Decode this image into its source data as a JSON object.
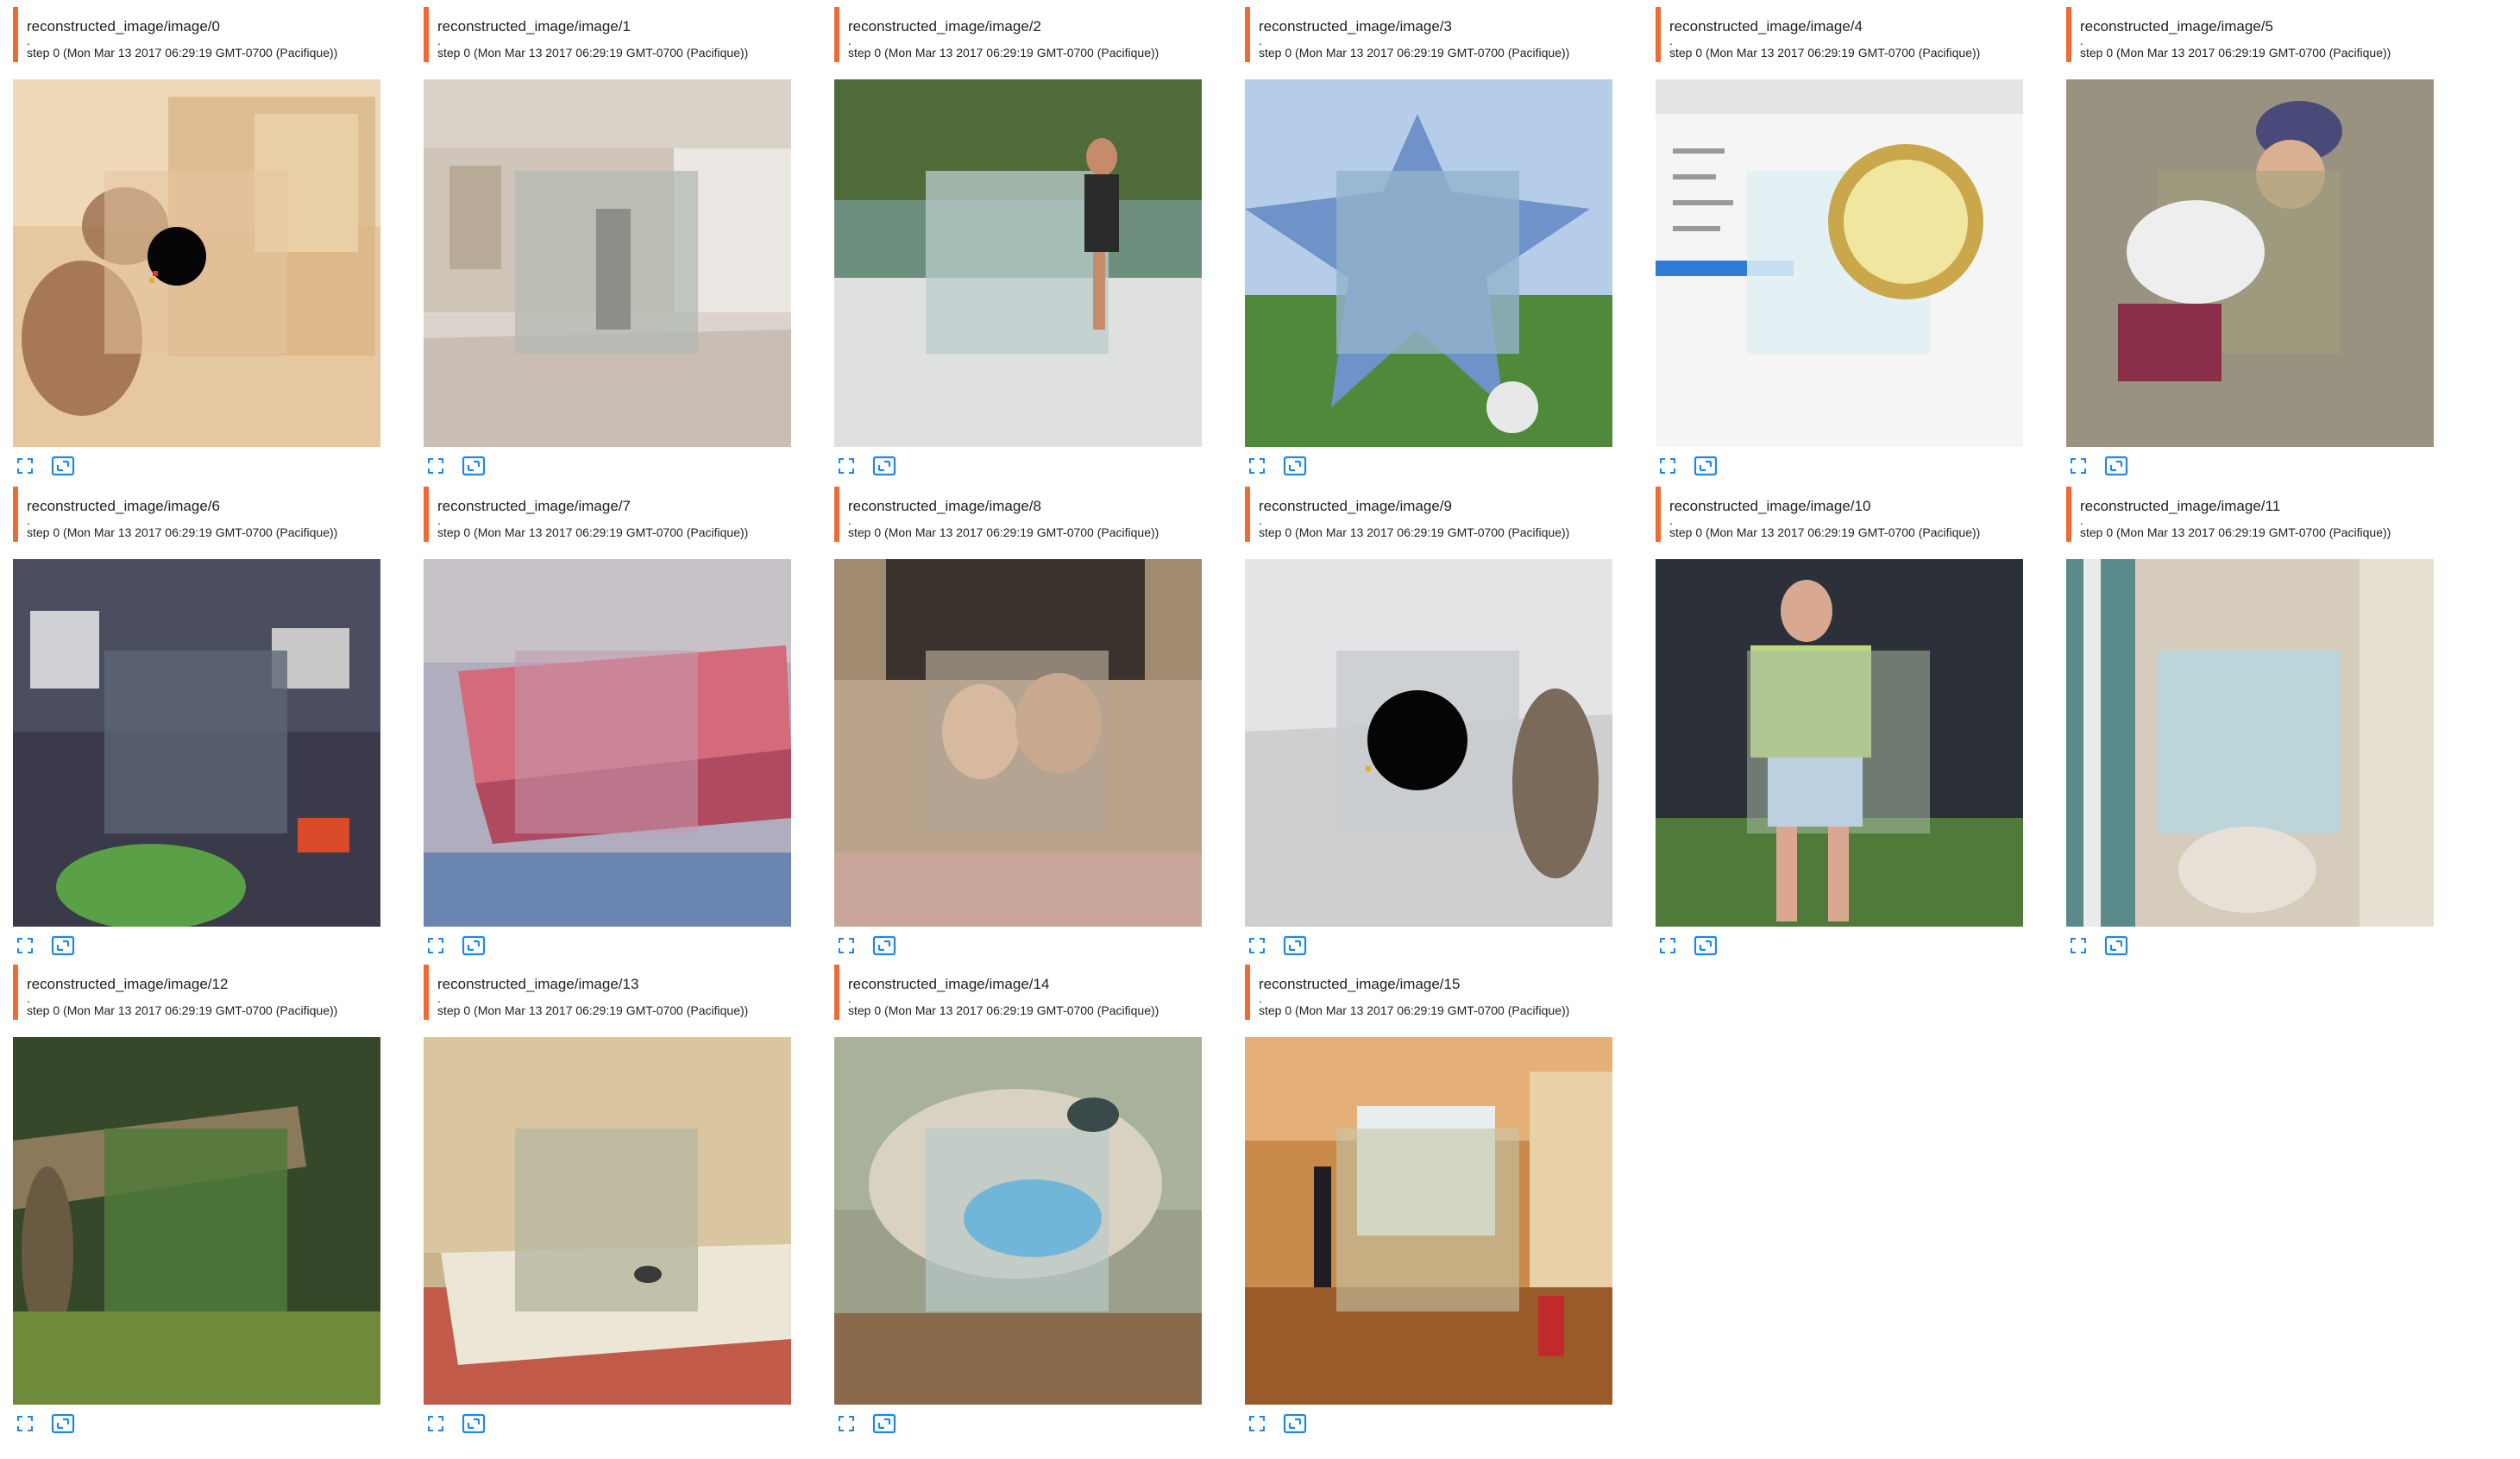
{
  "cards": [
    {
      "title": "reconstructed_image/image/0",
      "dot": ".",
      "step": "step 0 (Mon Mar 13 2017 06:29:19 GMT-0700 (Pacifique))"
    },
    {
      "title": "reconstructed_image/image/1",
      "dot": ".",
      "step": "step 0 (Mon Mar 13 2017 06:29:19 GMT-0700 (Pacifique))"
    },
    {
      "title": "reconstructed_image/image/2",
      "dot": ".",
      "step": "step 0 (Mon Mar 13 2017 06:29:19 GMT-0700 (Pacifique))"
    },
    {
      "title": "reconstructed_image/image/3",
      "dot": ".",
      "step": "step 0 (Mon Mar 13 2017 06:29:19 GMT-0700 (Pacifique))"
    },
    {
      "title": "reconstructed_image/image/4",
      "dot": ".",
      "step": "step 0 (Mon Mar 13 2017 06:29:19 GMT-0700 (Pacifique))"
    },
    {
      "title": "reconstructed_image/image/5",
      "dot": ".",
      "step": "step 0 (Mon Mar 13 2017 06:29:19 GMT-0700 (Pacifique))"
    },
    {
      "title": "reconstructed_image/image/6",
      "dot": ".",
      "step": "step 0 (Mon Mar 13 2017 06:29:19 GMT-0700 (Pacifique))"
    },
    {
      "title": "reconstructed_image/image/7",
      "dot": ".",
      "step": "step 0 (Mon Mar 13 2017 06:29:19 GMT-0700 (Pacifique))"
    },
    {
      "title": "reconstructed_image/image/8",
      "dot": ".",
      "step": "step 0 (Mon Mar 13 2017 06:29:19 GMT-0700 (Pacifique))"
    },
    {
      "title": "reconstructed_image/image/9",
      "dot": ".",
      "step": "step 0 (Mon Mar 13 2017 06:29:19 GMT-0700 (Pacifique))"
    },
    {
      "title": "reconstructed_image/image/10",
      "dot": ".",
      "step": "step 0 (Mon Mar 13 2017 06:29:19 GMT-0700 (Pacifique))"
    },
    {
      "title": "reconstructed_image/image/11",
      "dot": ".",
      "step": "step 0 (Mon Mar 13 2017 06:29:19 GMT-0700 (Pacifique))"
    },
    {
      "title": "reconstructed_image/image/12",
      "dot": ".",
      "step": "step 0 (Mon Mar 13 2017 06:29:19 GMT-0700 (Pacifique))"
    },
    {
      "title": "reconstructed_image/image/13",
      "dot": ".",
      "step": "step 0 (Mon Mar 13 2017 06:29:19 GMT-0700 (Pacifique))"
    },
    {
      "title": "reconstructed_image/image/14",
      "dot": ".",
      "step": "step 0 (Mon Mar 13 2017 06:29:19 GMT-0700 (Pacifique))"
    },
    {
      "title": "reconstructed_image/image/15",
      "dot": ".",
      "step": "step 0 (Mon Mar 13 2017 06:29:19 GMT-0700 (Pacifique))"
    }
  ],
  "icons": {
    "expand": "fullscreen-icon",
    "actual_size": "image-size-icon"
  },
  "colors": {
    "accent": "#f06b33",
    "icon": "#1e88e5"
  }
}
